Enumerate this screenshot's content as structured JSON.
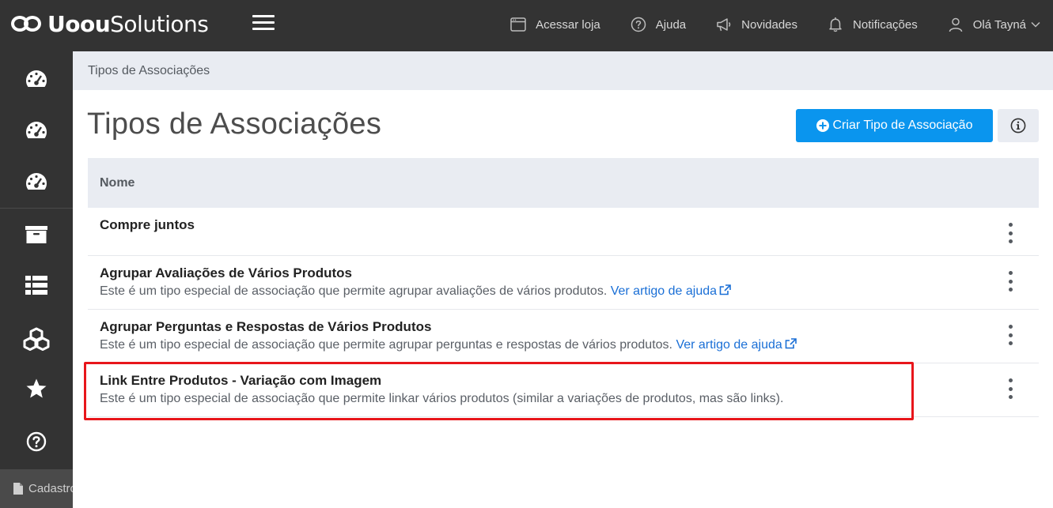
{
  "brand": {
    "name_bold": "Uoou",
    "name_light": "Solutions"
  },
  "topnav": {
    "store": "Acessar loja",
    "help": "Ajuda",
    "news": "Novidades",
    "notifications": "Notificações",
    "user": "Olá Tayná"
  },
  "sidebar": {
    "bottom_label": "Cadastros"
  },
  "breadcrumb": "Tipos de Associações",
  "page": {
    "title": "Tipos de Associações",
    "create_button": "Criar Tipo de Associação"
  },
  "table": {
    "column_name": "Nome",
    "rows": [
      {
        "title": "Compre juntos",
        "desc": "",
        "link": ""
      },
      {
        "title": "Agrupar Avaliações de Vários Produtos",
        "desc": "Este é um tipo especial de associação que permite agrupar avaliações de vários produtos.",
        "link": "Ver artigo de ajuda"
      },
      {
        "title": "Agrupar Perguntas e Respostas de Vários Produtos",
        "desc": "Este é um tipo especial de associação que permite agrupar perguntas e respostas de vários produtos.",
        "link": "Ver artigo de ajuda"
      },
      {
        "title": "Link Entre Produtos - Variação com Imagem",
        "desc": "Este é um tipo especial de associação que permite linkar vários produtos (similar a variações de produtos, mas são links).",
        "link": ""
      }
    ]
  },
  "colors": {
    "topbar": "#333333",
    "primary": "#0a95ee",
    "link": "#1a6fd6",
    "highlight": "#e8161b",
    "header_bg": "#e9ecf2"
  },
  "icons": {
    "store": "browser-window-icon",
    "help": "question-circle-icon",
    "news": "megaphone-icon",
    "notifications": "bell-icon",
    "user": "user-icon",
    "sidebar": [
      "dashboard-gauge-icon",
      "dashboard-gauge-icon",
      "dashboard-gauge-icon",
      "box-icon",
      "list-icon",
      "cubes-icon",
      "star-icon",
      "question-circle-icon"
    ]
  }
}
